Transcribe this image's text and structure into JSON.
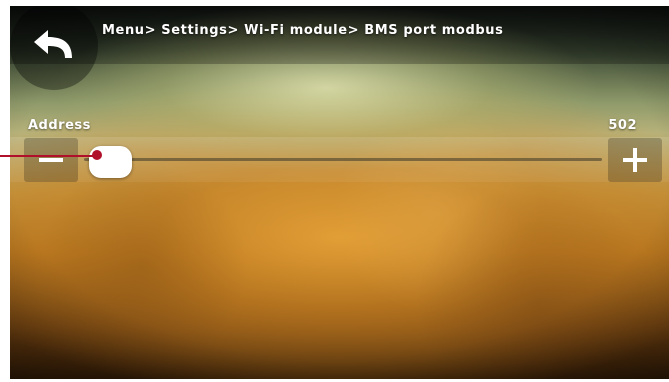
{
  "header": {
    "breadcrumb": "Menu> Settings> Wi-Fi module> BMS port modbus"
  },
  "icons": {
    "back": "back-arrow-icon",
    "decrement": "minus-icon",
    "increment": "plus-icon"
  },
  "parameter": {
    "label": "Address",
    "value": "502"
  },
  "colors": {
    "callout": "#b0102a",
    "text": "#ffffff",
    "thumb": "#ffffff"
  }
}
